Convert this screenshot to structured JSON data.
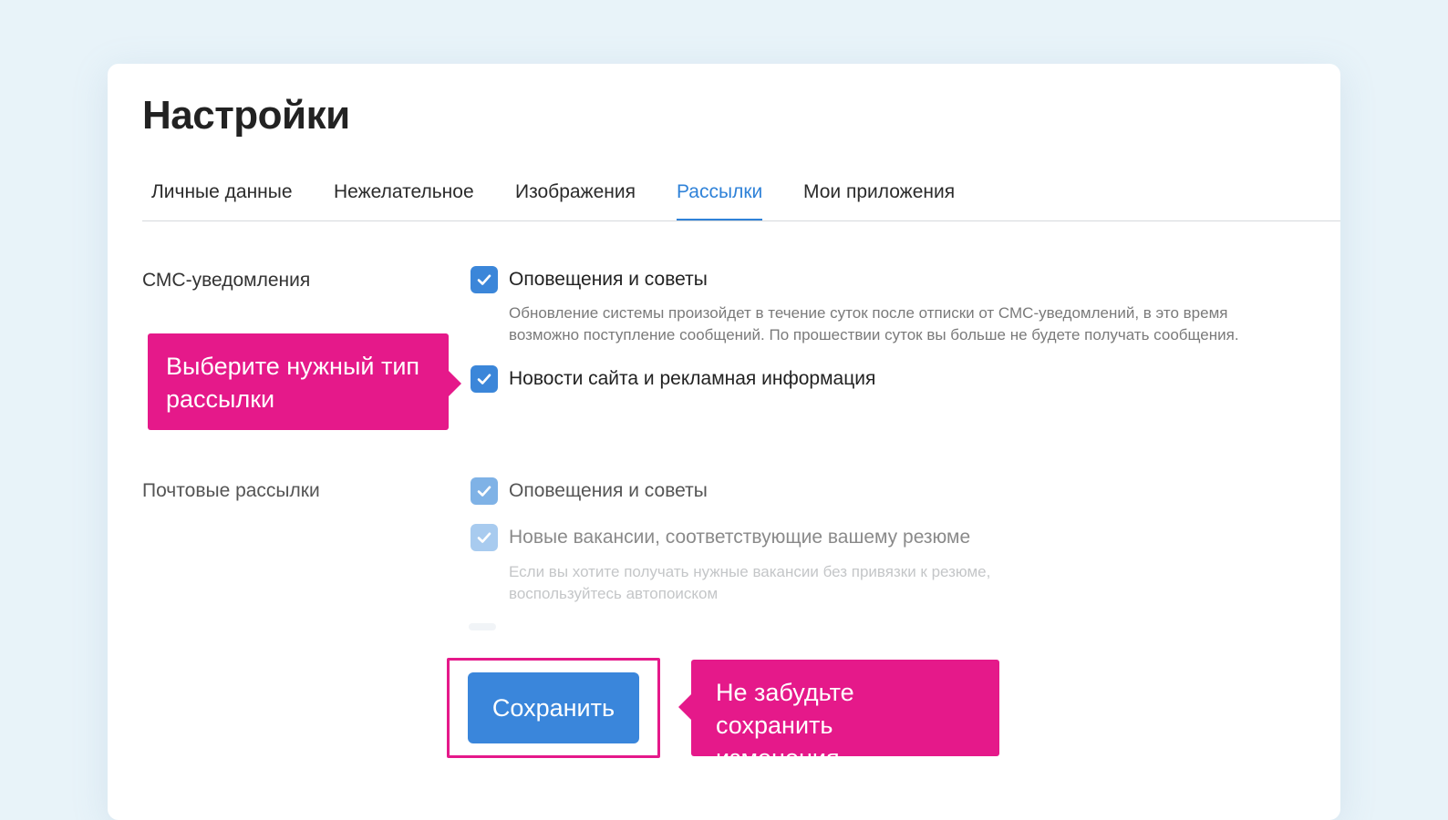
{
  "page": {
    "title": "Настройки"
  },
  "tabs": [
    {
      "label": "Личные данные"
    },
    {
      "label": "Нежелательное"
    },
    {
      "label": "Изображения"
    },
    {
      "label": "Рассылки",
      "active": true
    },
    {
      "label": "Мои приложения"
    }
  ],
  "sms": {
    "label": "СМС-уведомления",
    "options": [
      {
        "label": "Оповещения и советы",
        "checked": true
      },
      {
        "label": "Новости сайта и рекламная информация",
        "checked": true
      }
    ],
    "hint_line1": "Обновление системы произойдет в течение суток после отписки от СМС-уведомлений, в это время",
    "hint_line2": "возможно поступление сообщений. По прошествии суток вы больше не будете получать сообщения."
  },
  "mail": {
    "label": "Почтовые рассылки",
    "options": [
      {
        "label": "Оповещения и советы",
        "checked": true
      },
      {
        "label": "Новые вакансии, соответствующие вашему резюме",
        "checked": true
      }
    ],
    "hint_line1": "Если вы хотите получать нужные вакансии без привязки к резюме,",
    "hint_line2": "воспользуйтесь автопоиском"
  },
  "actions": {
    "save_label": "Сохранить"
  },
  "callouts": {
    "type_line1": "Выберите нужный тип",
    "type_line2": "рассылки",
    "save_line1": "Не забудьте сохранить",
    "save_line2": "изменения"
  },
  "colors": {
    "accent": "#3a86db",
    "callout": "#e5198a",
    "background": "#e8f3f9"
  },
  "icons": {
    "checkbox": "check-icon"
  }
}
